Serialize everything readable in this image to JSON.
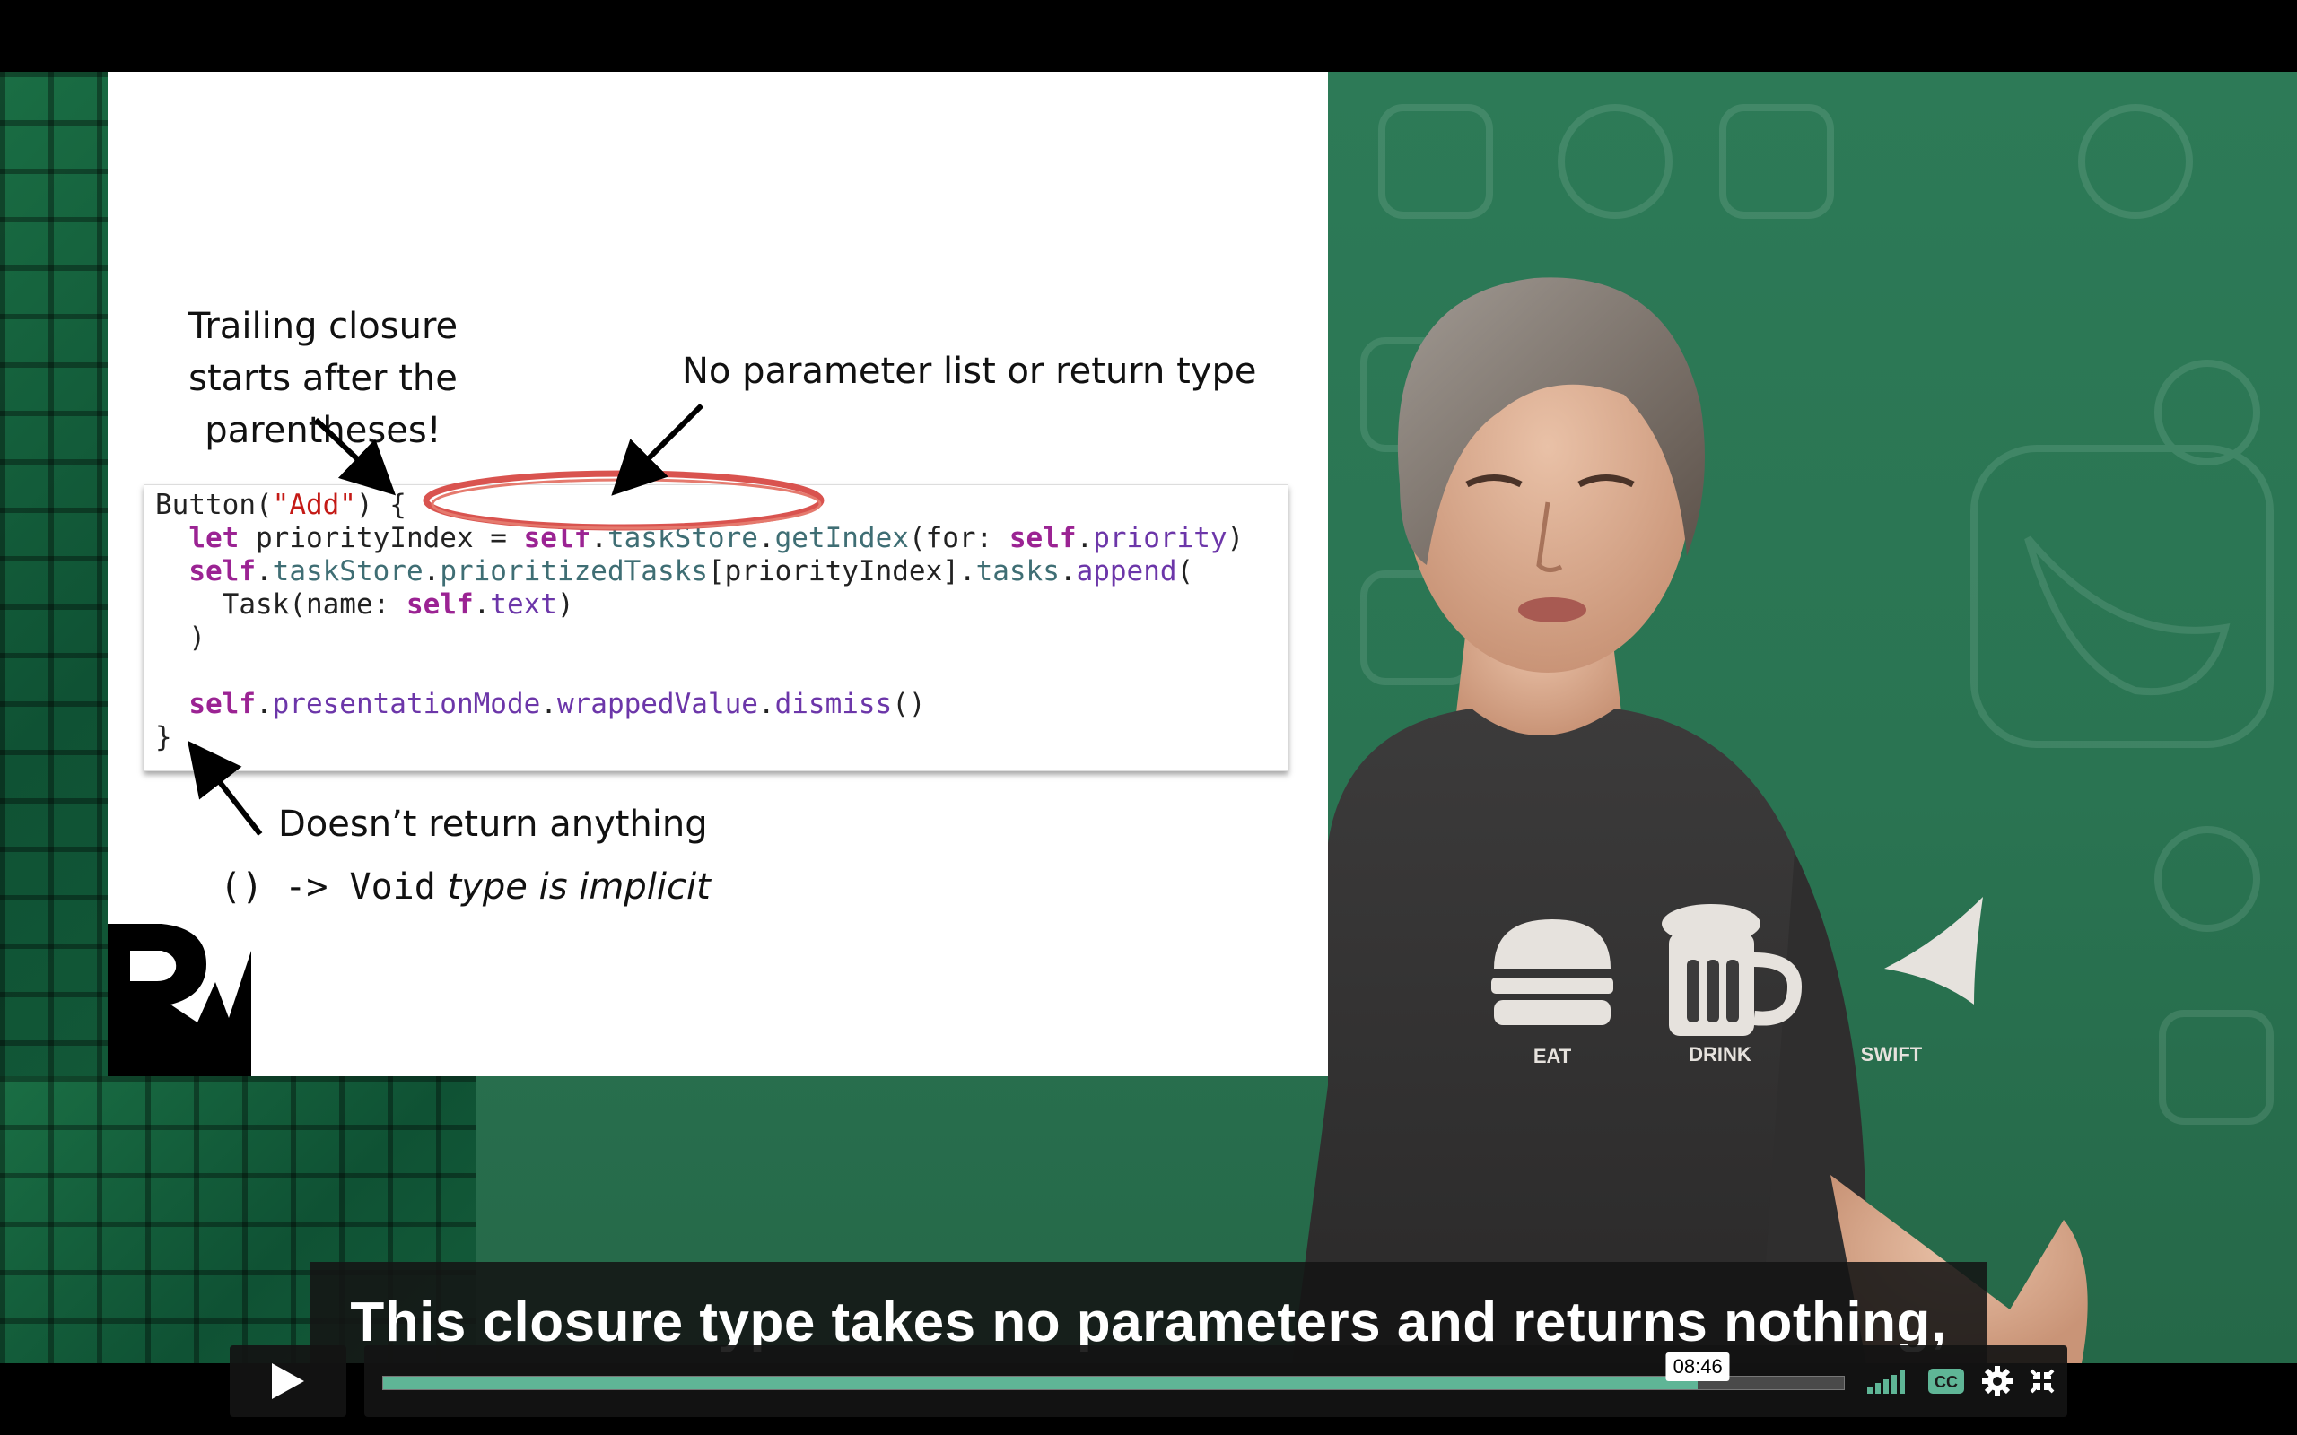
{
  "slide": {
    "annotation_trailing": "Trailing closure starts after the  parentheses!",
    "annotation_no_param": "No parameter list or return type",
    "annotation_doesnt_return": "Doesn’t return anything",
    "annotation_void_type": "() -> Void",
    "annotation_void_suffix": "type is implicit",
    "code": {
      "line1_fn": "Button(",
      "line1_str": "\"Add\"",
      "line1_end": ") {",
      "line2_indent": "  ",
      "line2_kw": "let",
      "line2_a": " priorityIndex = ",
      "line2_self": "self",
      "line2_b": ".",
      "line2_c": "taskStore",
      "line2_d": ".",
      "line2_e": "getIndex",
      "line2_f": "(for: ",
      "line2_self2": "self",
      "line2_g": ".",
      "line2_h": "priority",
      "line2_i": ")",
      "line3_indent": "  ",
      "line3_self": "self",
      "line3_a": ".",
      "line3_b": "taskStore",
      "line3_c": ".",
      "line3_d": "prioritizedTasks",
      "line3_e": "[priorityIndex].",
      "line3_f": "tasks",
      "line3_g": ".",
      "line3_h": "append",
      "line3_i": "(",
      "line4_a": "    Task(name: ",
      "line4_self": "self",
      "line4_b": ".",
      "line4_c": "text",
      "line4_d": ")",
      "line5": "  )",
      "line6": "",
      "line7_indent": "  ",
      "line7_self": "self",
      "line7_a": ".",
      "line7_b": "presentationMode",
      "line7_c": ".",
      "line7_d": "wrappedValue",
      "line7_e": ".",
      "line7_f": "dismiss",
      "line7_g": "()",
      "line8": "}"
    }
  },
  "shirt": {
    "label_eat": "EAT",
    "label_drink": "DRINK",
    "label_swift": "SWIFT"
  },
  "caption": {
    "text": "This closure type takes no parameters and returns nothing,"
  },
  "controls": {
    "current_time": "08:46",
    "progress_fraction": 0.9,
    "play_icon": "play-icon",
    "volume_icon": "volume-bars-icon",
    "cc_label": "CC",
    "settings_icon": "gear-icon",
    "fullscreen_icon": "exit-fullscreen-icon"
  },
  "colors": {
    "accent": "#5fb596",
    "background_green": "#2a7452",
    "highlight_ellipse": "#d9534f"
  }
}
